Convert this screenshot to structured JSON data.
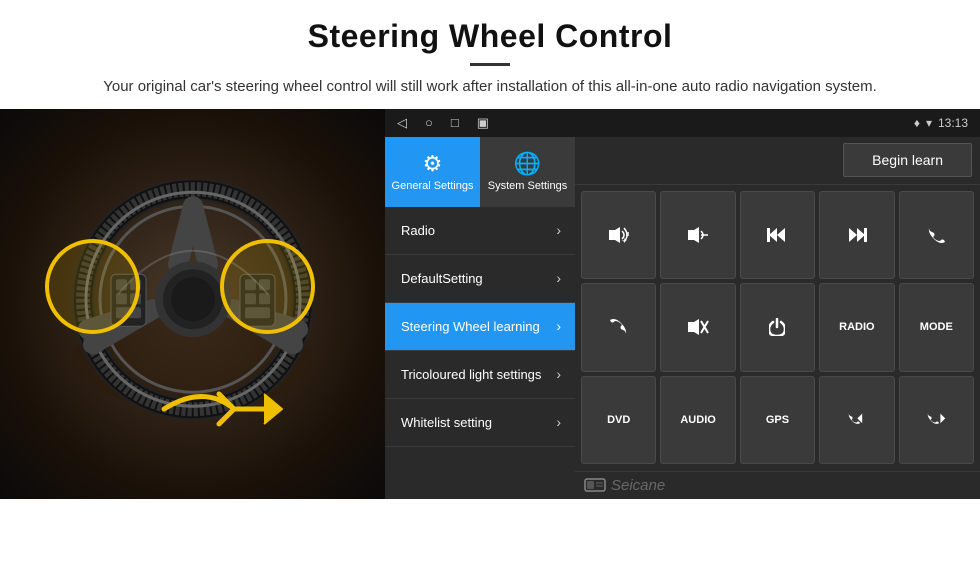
{
  "header": {
    "title": "Steering Wheel Control",
    "description": "Your original car's steering wheel control will still work after installation of this all-in-one auto radio navigation system."
  },
  "statusBar": {
    "time": "13:13",
    "icons": [
      "◁",
      "○",
      "□",
      "▣"
    ]
  },
  "tabs": [
    {
      "id": "general",
      "label": "General Settings",
      "active": true
    },
    {
      "id": "system",
      "label": "System Settings",
      "active": false
    }
  ],
  "menuItems": [
    {
      "id": "radio",
      "label": "Radio",
      "active": false
    },
    {
      "id": "default",
      "label": "DefaultSetting",
      "active": false
    },
    {
      "id": "steering",
      "label": "Steering Wheel learning",
      "active": true
    },
    {
      "id": "tricoloured",
      "label": "Tricoloured light settings",
      "active": false
    },
    {
      "id": "whitelist",
      "label": "Whitelist setting",
      "active": false
    }
  ],
  "buttons": {
    "beginLearn": "Begin learn",
    "controls": [
      {
        "id": "vol-up",
        "label": "🔊+",
        "type": "icon"
      },
      {
        "id": "vol-down",
        "label": "🔇-",
        "type": "icon"
      },
      {
        "id": "prev-track",
        "label": "⏮",
        "type": "icon"
      },
      {
        "id": "next-track",
        "label": "⏭",
        "type": "icon"
      },
      {
        "id": "phone",
        "label": "📞",
        "type": "icon"
      },
      {
        "id": "hang-up",
        "label": "↩",
        "type": "icon"
      },
      {
        "id": "mute",
        "label": "🔇×",
        "type": "icon"
      },
      {
        "id": "power",
        "label": "⏻",
        "type": "icon"
      },
      {
        "id": "radio-btn",
        "label": "RADIO",
        "type": "text"
      },
      {
        "id": "mode",
        "label": "MODE",
        "type": "text"
      },
      {
        "id": "dvd",
        "label": "DVD",
        "type": "text"
      },
      {
        "id": "audio",
        "label": "AUDIO",
        "type": "text"
      },
      {
        "id": "gps",
        "label": "GPS",
        "type": "text"
      },
      {
        "id": "tel-prev",
        "label": "📞⏮",
        "type": "icon"
      },
      {
        "id": "tel-next",
        "label": "📞⏭",
        "type": "icon"
      }
    ]
  },
  "watermark": "Seicane"
}
